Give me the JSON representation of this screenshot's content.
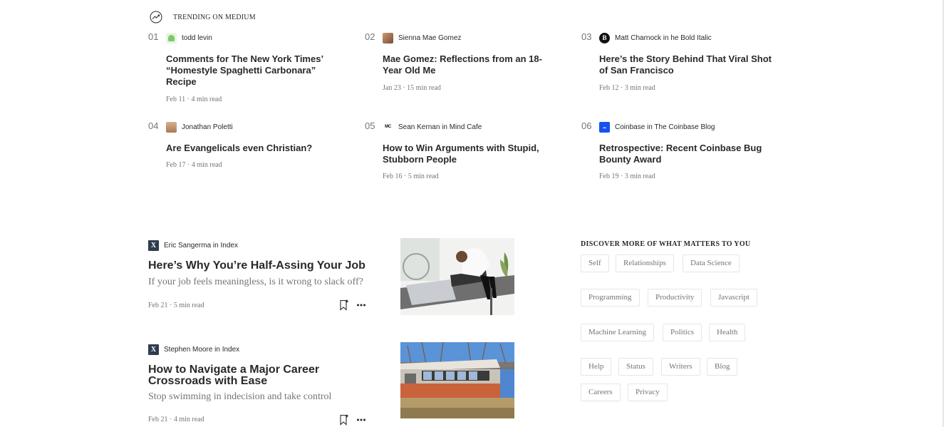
{
  "trending": {
    "label": "TRENDING ON MEDIUM",
    "items": [
      {
        "num": "01",
        "author": "todd levin",
        "title": "Comments for The New York Times’ “Homestyle Spaghetti Carbonara” Recipe",
        "meta": "Feb 11 · 4 min read"
      },
      {
        "num": "02",
        "author": "Sienna Mae Gomez",
        "title": "Mae Gomez: Reflections from an 18-Year Old Me",
        "meta": "Jan 23 · 15 min read"
      },
      {
        "num": "03",
        "author": "Matt Charnock in he Bold Italic",
        "title": "Here’s the Story Behind That Viral Shot of San Francisco",
        "meta": "Feb 12 · 3 min read"
      },
      {
        "num": "04",
        "author": "Jonathan Poletti",
        "title": "Are Evangelicals even Christian?",
        "meta": "Feb 17 · 4 min read"
      },
      {
        "num": "05",
        "author": "Sean Kernan in Mind Cafe",
        "title": "How to Win Arguments with Stupid, Stubborn People",
        "meta": "Feb 16 · 5 min read"
      },
      {
        "num": "06",
        "author": "Coinbase in The Coinbase Blog",
        "title": "Retrospective: Recent Coinbase Bug Bounty Award",
        "meta": "Feb 19 · 3 min read"
      }
    ]
  },
  "articles": [
    {
      "author": "Eric Sangerma in Index",
      "title": "Here’s Why You’re Half-Assing Your Job",
      "subtitle": "If your job feels meaningless, is it wrong to slack off?",
      "meta": "Feb 21 · 5 min read"
    },
    {
      "author": "Stephen Moore in Index",
      "title": "How to Navigate a Major Career Crossroads with Ease",
      "subtitle": "Stop swimming in indecision and take control",
      "meta": "Feb 21 · 4 min read"
    }
  ],
  "discover": {
    "title": "DISCOVER MORE OF WHAT MATTERS TO YOU",
    "tags": [
      "Self",
      "Relationships",
      "Data Science",
      "Programming",
      "Productivity",
      "Javascript",
      "Machine Learning",
      "Politics",
      "Health"
    ]
  },
  "footer": {
    "links": [
      "Help",
      "Status",
      "Writers",
      "Blog",
      "Careers",
      "Privacy"
    ]
  },
  "icons": {
    "trending": "trending-up-icon",
    "bookmark": "bookmark-icon",
    "more": "more-horizontal-icon"
  }
}
